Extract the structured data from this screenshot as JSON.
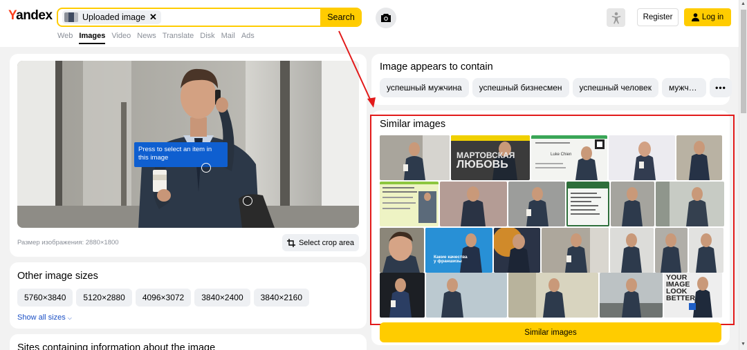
{
  "header": {
    "logo": "Yandex",
    "search_chip": "Uploaded image",
    "search_chip_close": "✕",
    "search_button": "Search",
    "nav": [
      "Web",
      "Images",
      "Video",
      "News",
      "Translate",
      "Disk",
      "Mail",
      "Ads"
    ],
    "nav_active_index": 1,
    "register": "Register",
    "login": "Log in"
  },
  "main_image": {
    "tooltip": "Press to select an item in this image",
    "size_label": "Размер изображения: 2880×1800",
    "crop_button": "Select crop area"
  },
  "other_sizes": {
    "title": "Other image sizes",
    "sizes": [
      "5760×3840",
      "5120×2880",
      "4096×3072",
      "3840×2400",
      "3840×2160"
    ],
    "show_all": "Show all sizes"
  },
  "sites": {
    "title": "Sites containing information about the image"
  },
  "contains": {
    "title": "Image appears to contain",
    "tags": [
      "успешный мужчина",
      "успешный бизнесмен",
      "успешный человек",
      "мужч…"
    ],
    "more": "•••"
  },
  "similar": {
    "title": "Similar images",
    "button": "Similar images",
    "tile_texts": {
      "r1_t2": [
        "МАРТОВСКАЯ",
        "ЛЮБОВЬ"
      ],
      "r1_t3": "Luke Chien",
      "r3_t2": [
        "Какие качества",
        "у франшизы"
      ],
      "r4_t5": [
        "YOUR",
        "IMAGE",
        "LOOK",
        "BETTER"
      ]
    }
  },
  "colors": {
    "accent": "#ffcc00",
    "highlight": "#e21a1a",
    "tooltip": "#0f5fd0",
    "link": "#1a4fc5"
  }
}
